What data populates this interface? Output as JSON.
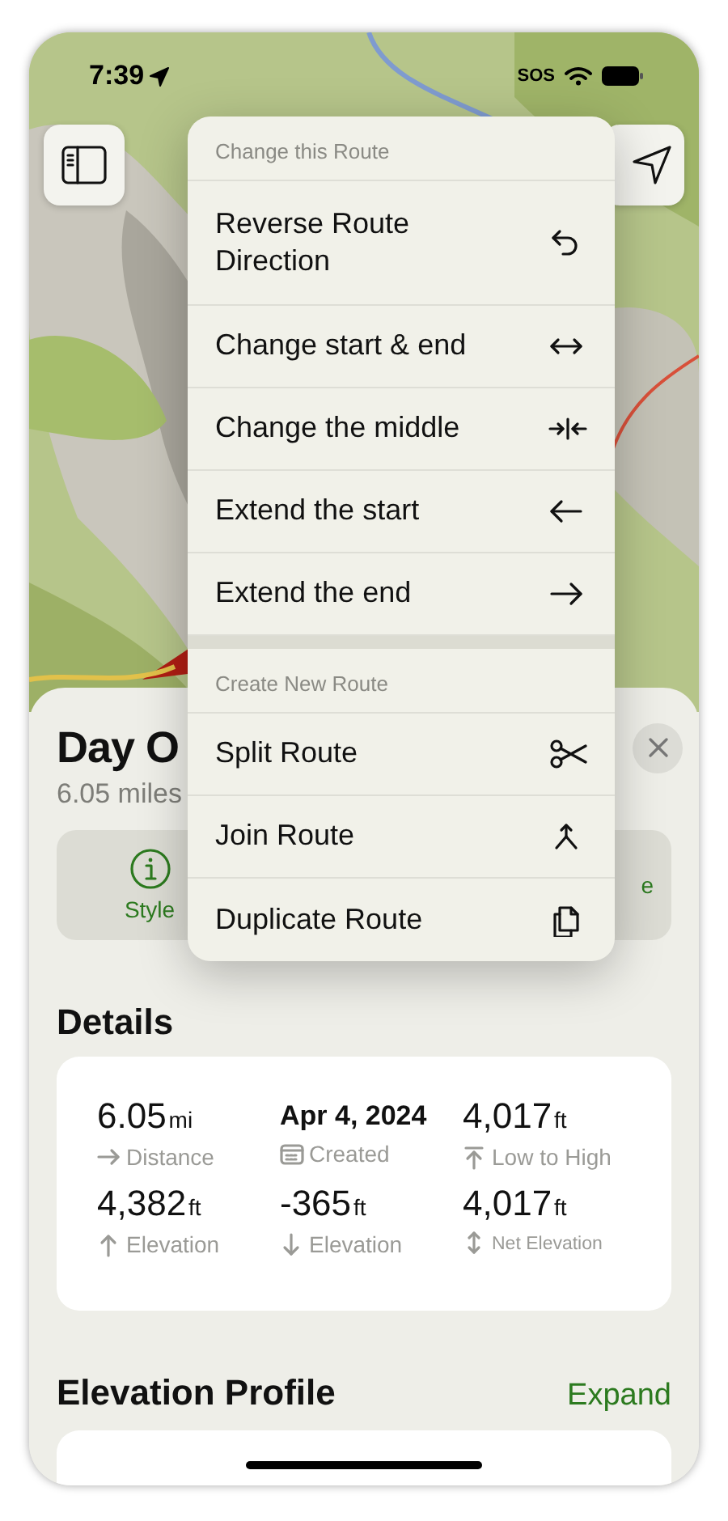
{
  "status_bar": {
    "time": "7:39",
    "carrier": "SOS"
  },
  "menu": {
    "sections": [
      {
        "header": "Change this Route",
        "items": [
          {
            "label": "Reverse Route Direction"
          },
          {
            "label": "Change start & end"
          },
          {
            "label": "Change the middle"
          },
          {
            "label": "Extend the start"
          },
          {
            "label": "Extend the end"
          }
        ]
      },
      {
        "header": "Create New Route",
        "items": [
          {
            "label": "Split Route"
          },
          {
            "label": "Join Route"
          },
          {
            "label": "Duplicate Route"
          }
        ]
      }
    ]
  },
  "route": {
    "title": "Day O",
    "subtitle": "6.05 miles",
    "actions": [
      {
        "label": "Style"
      },
      {
        "label": "e"
      }
    ]
  },
  "details": {
    "heading": "Details",
    "stats": [
      {
        "value": "6.05",
        "unit": "mi",
        "label": "Distance"
      },
      {
        "value": "Apr 4, 2024",
        "label": "Created"
      },
      {
        "value": "4,017",
        "unit": "ft",
        "label": "Low to High"
      },
      {
        "value": "4,382",
        "unit": "ft",
        "label": "Elevation"
      },
      {
        "value": "-365",
        "unit": "ft",
        "label": "Elevation"
      },
      {
        "value": "4,017",
        "unit": "ft",
        "label": "Net Elevation"
      }
    ]
  },
  "elevation_profile": {
    "heading": "Elevation Profile",
    "action": "Expand"
  }
}
